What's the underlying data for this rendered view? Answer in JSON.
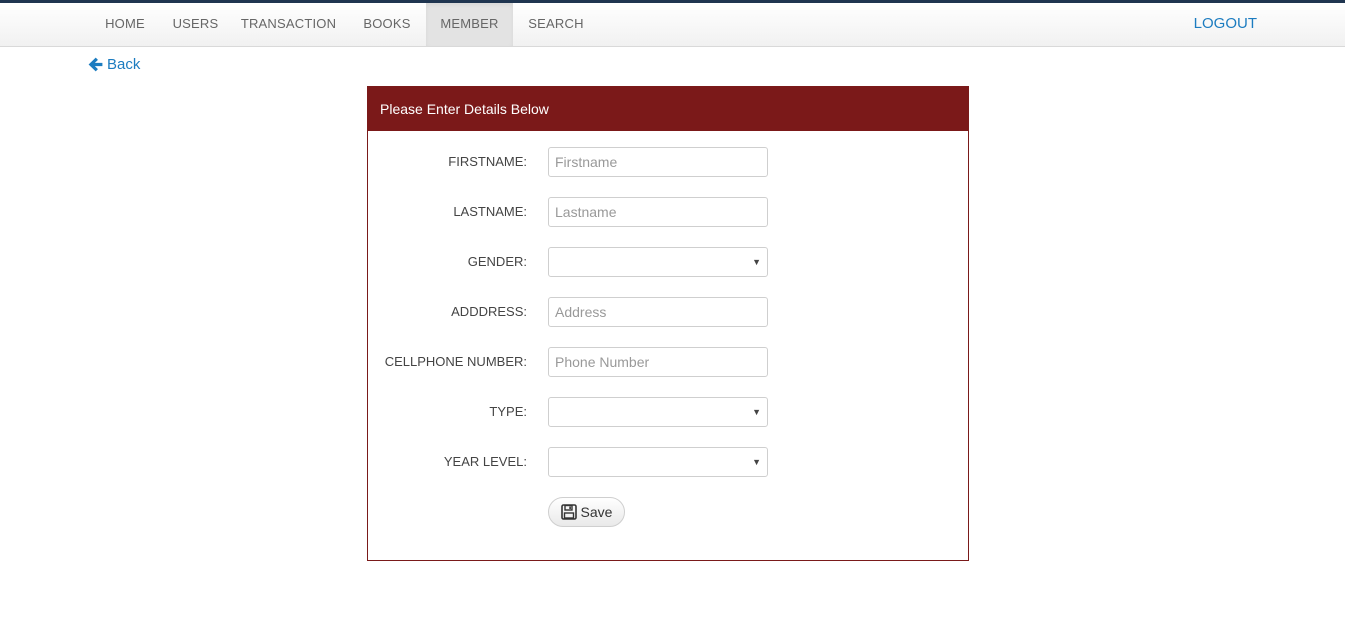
{
  "nav": {
    "items": [
      {
        "label": "HOME"
      },
      {
        "label": "USERS"
      },
      {
        "label": "TRANSACTION"
      },
      {
        "label": "BOOKS"
      },
      {
        "label": "MEMBER"
      },
      {
        "label": "SEARCH"
      }
    ],
    "active": "MEMBER",
    "logout_label": "LOGOUT"
  },
  "back": {
    "label": "Back",
    "icon": "arrow-left-icon"
  },
  "panel": {
    "title": "Please Enter Details Below"
  },
  "form": {
    "firstname": {
      "label": "FIRSTNAME:",
      "placeholder": "Firstname",
      "value": ""
    },
    "lastname": {
      "label": "LASTNAME:",
      "placeholder": "Lastname",
      "value": ""
    },
    "gender": {
      "label": "GENDER:",
      "selected": ""
    },
    "address": {
      "label": "ADDDRESS:",
      "placeholder": "Address",
      "value": ""
    },
    "cellphone": {
      "label": "CELLPHONE NUMBER:",
      "placeholder": "Phone Number",
      "value": ""
    },
    "type": {
      "label": "TYPE:",
      "selected": ""
    },
    "year_level": {
      "label": "YEAR LEVEL:",
      "selected": ""
    },
    "save_label": "Save",
    "save_icon": "floppy-disk-icon"
  },
  "colors": {
    "accent": "#1c7cc0",
    "panel_header": "#7b1919",
    "top_border": "#1f3550"
  }
}
